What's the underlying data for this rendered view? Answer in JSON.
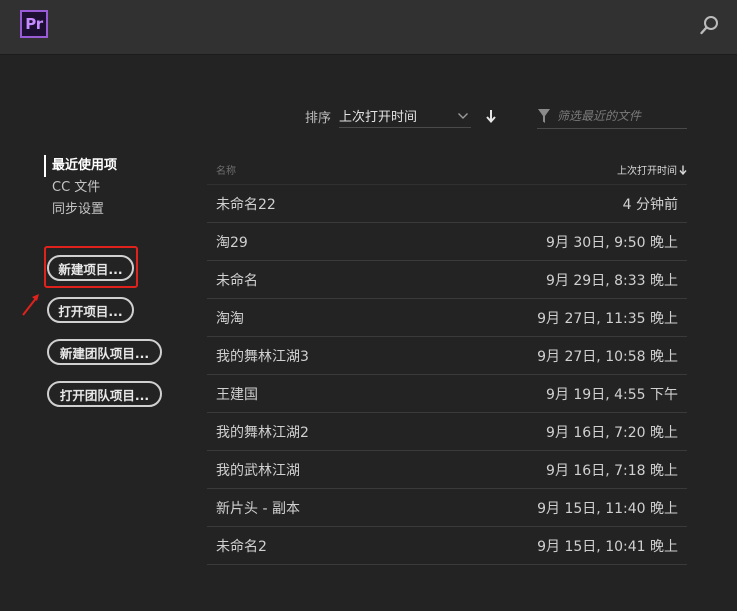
{
  "app": {
    "logo_text": "Pr"
  },
  "colors": {
    "accent_purple": "#9a5bd6",
    "highlight_red": "#e0221d",
    "background": "#232323"
  },
  "topbar": {
    "search_icon": "search-icon"
  },
  "sort": {
    "label": "排序",
    "selected": "上次打开时间",
    "direction_icon": "arrow-down-icon"
  },
  "filter": {
    "placeholder": "筛选最近的文件",
    "value": ""
  },
  "sidebar": {
    "items": [
      {
        "label": "最近使用项",
        "active": true
      },
      {
        "label": "CC 文件",
        "active": false
      },
      {
        "label": "同步设置",
        "active": false
      }
    ]
  },
  "buttons": {
    "new_project": "新建项目...",
    "open_project": "打开项目...",
    "new_team_project": "新建团队项目...",
    "open_team_project": "打开团队项目..."
  },
  "table": {
    "col_name": "名称",
    "col_date": "上次打开时间",
    "rows": [
      {
        "name": "未命名22",
        "date": "4 分钟前"
      },
      {
        "name": "淘29",
        "date": "9月 30日, 9:50 晚上"
      },
      {
        "name": "未命名",
        "date": "9月 29日, 8:33 晚上"
      },
      {
        "name": "淘淘",
        "date": "9月 27日, 11:35 晚上"
      },
      {
        "name": "我的舞林江湖3",
        "date": "9月 27日, 10:58 晚上"
      },
      {
        "name": "王建国",
        "date": "9月 19日, 4:55 下午"
      },
      {
        "name": "我的舞林江湖2",
        "date": "9月 16日, 7:20 晚上"
      },
      {
        "name": "我的武林江湖",
        "date": "9月 16日, 7:18 晚上"
      },
      {
        "name": "新片头 - 副本",
        "date": "9月 15日, 11:40 晚上"
      },
      {
        "name": "未命名2",
        "date": "9月 15日, 10:41 晚上"
      }
    ]
  }
}
